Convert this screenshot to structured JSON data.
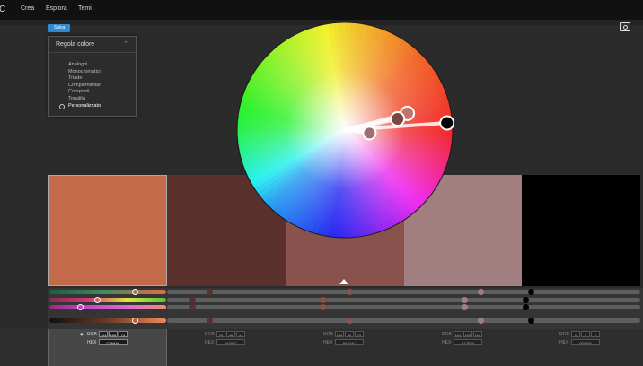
{
  "header": {
    "logo": "C",
    "nav": [
      "Crea",
      "Esplora",
      "Temi"
    ]
  },
  "toolbar": {
    "save_label": "Salva"
  },
  "rule_panel": {
    "title": "Regola colore",
    "items": [
      "Analoghi",
      "Monocromatici",
      "Triade",
      "Complementari",
      "Composti",
      "Tonalità",
      "Personalizzato"
    ],
    "selected": "Personalizzato"
  },
  "swatches": [
    "#C26A4A",
    "#5A302C",
    "#8A524C",
    "#A17E80",
    "#000000"
  ],
  "wheel_markers": [
    {
      "angle": 15,
      "radius": 0.6,
      "color": "#c2746a",
      "base": false
    },
    {
      "angle": 12,
      "radius": 0.5,
      "color": "#7a4640",
      "base": false
    },
    {
      "angle": 4,
      "radius": 0.95,
      "color": "#000000",
      "base": false
    },
    {
      "angle": -7,
      "radius": 0.23,
      "color": "#a06e70",
      "base": true
    }
  ],
  "color_fields": [
    {
      "r": "194",
      "g": "106",
      "b": "74",
      "hex": "C26A4A",
      "rgb_label": "RGB",
      "hex_label": "HEX",
      "active": true
    },
    {
      "r": "90",
      "g": "48",
      "b": "44",
      "hex": "5A302C",
      "rgb_label": "RGB",
      "hex_label": "HEX",
      "active": false
    },
    {
      "r": "138",
      "g": "82",
      "b": "76",
      "hex": "8A524C",
      "rgb_label": "RGB",
      "hex_label": "HEX",
      "active": false
    },
    {
      "r": "161",
      "g": "126",
      "b": "128",
      "hex": "A17E80",
      "rgb_label": "RGB",
      "hex_label": "HEX",
      "active": false
    },
    {
      "r": "0",
      "g": "0",
      "b": "0",
      "hex": "000000",
      "rgb_label": "RGB",
      "hex_label": "HEX",
      "active": false
    }
  ],
  "colors": {
    "accent": "#2e8bd6"
  }
}
